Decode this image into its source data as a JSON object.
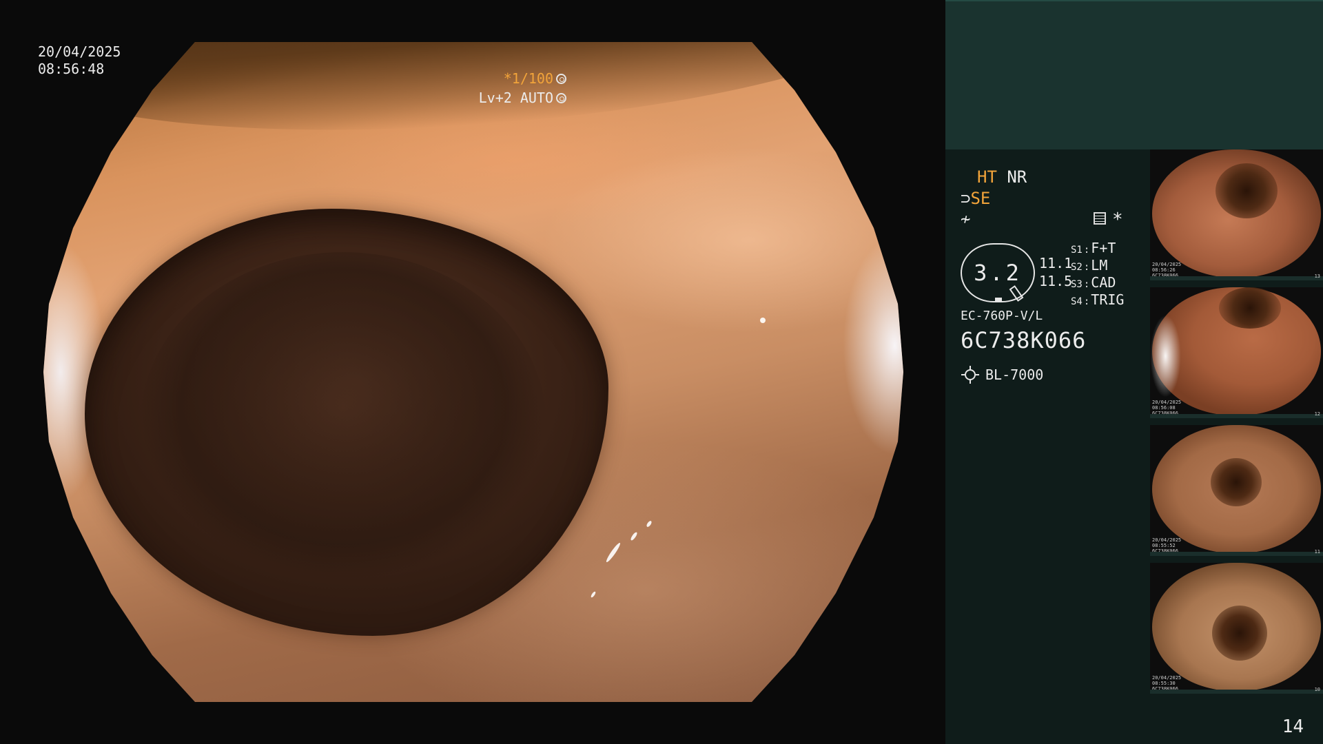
{
  "overlay": {
    "date": "20/04/2025",
    "time": "08:56:48",
    "shutter_speed": "*1/100",
    "brightness_mode": "Lv+2 AUTO"
  },
  "processor_info": {
    "ht": "HT",
    "nr": "NR",
    "se": "SE",
    "se_icon": "scope-se-icon",
    "curve_icon": "enhance-curve-icon",
    "menu_icon": "settings-menu-icon",
    "asterisk": "*",
    "gauge_value": "3.2",
    "value_top": "11.1",
    "value_bottom": "11.5",
    "switches": [
      {
        "key": "S1",
        "sep": ":",
        "value": "F+T"
      },
      {
        "key": "S2",
        "sep": ":",
        "value": "LM"
      },
      {
        "key": "S3",
        "sep": ":",
        "value": "CAD"
      },
      {
        "key": "S4",
        "sep": ":",
        "value": "TRIG"
      }
    ],
    "scope_model": "EC-760P-V/L",
    "scope_serial": "6C738K066",
    "light_source": "BL-7000"
  },
  "thumbnails": [
    {
      "label_lines": [
        "20/04/2025",
        "08:56:26",
        "6C738K066"
      ],
      "number": "13"
    },
    {
      "label_lines": [
        "20/04/2025",
        "08:56:08",
        "6C738K066"
      ],
      "number": "12"
    },
    {
      "label_lines": [
        "20/04/2025",
        "08:55:52",
        "6C738K066"
      ],
      "number": "11"
    },
    {
      "label_lines": [
        "20/04/2025",
        "08:55:30",
        "6C738K066"
      ],
      "number": "10"
    }
  ],
  "page_number": "14",
  "colors": {
    "accent_orange": "#f2a43a",
    "panel_dark": "#0f1c1a",
    "panel_header": "#1a332f"
  }
}
